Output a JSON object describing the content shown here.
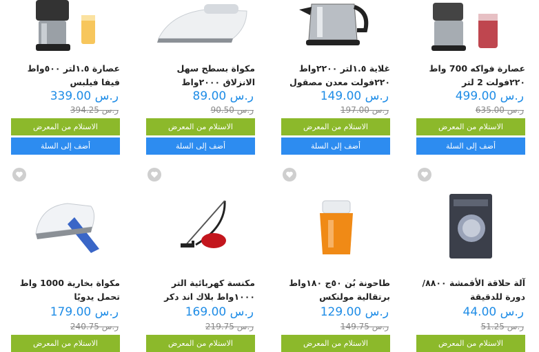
{
  "products": [
    {
      "name": "عصارة ١.٥لتر ٥٠٠واط فيفا فيلبس",
      "price": "ر.س 339.00",
      "old_price": "ر.س 394.25",
      "pickup_label": "الاستلام من المعرض",
      "cart_label": "أضف إلى السلة"
    },
    {
      "name": "مكواة بسطح سهل الانزلاق ٢٠٠٠واط",
      "price": "ر.س 89.00",
      "old_price": "ر.س 90.50",
      "pickup_label": "الاستلام من المعرض",
      "cart_label": "أضف إلى السلة"
    },
    {
      "name": "غلاية ١.٥لتر ٢٢٠٠واط ٢٢٠فولت معدن مصقول",
      "price": "ر.س 149.00",
      "old_price": "ر.س 197.00",
      "pickup_label": "الاستلام من المعرض",
      "cart_label": "أضف إلى السلة"
    },
    {
      "name": "عصارة فواكه 700 واط ٢٢٠فولت 2 لتر",
      "price": "ر.س 499.00",
      "old_price": "ر.س 635.00",
      "pickup_label": "الاستلام من المعرض",
      "cart_label": "أضف إلى السلة"
    },
    {
      "name": "مكواة بخارية 1000 واط تحمل يدويًا",
      "price": "ر.س 179.00",
      "old_price": "ر.س 240.75",
      "pickup_label": "الاستلام من المعرض",
      "cart_label": ""
    },
    {
      "name": "مكنسة كهربائية التر ١٠٠٠واط بلاك اند دكر",
      "price": "ر.س 169.00",
      "old_price": "ر.س 219.75",
      "pickup_label": "الاستلام من المعرض",
      "cart_label": ""
    },
    {
      "name": "طاحونة بُن ٥٠ج ١٨٠واط برتقالية مولنكس",
      "price": "ر.س 129.00",
      "old_price": "ر.س 149.75",
      "pickup_label": "الاستلام من المعرض",
      "cart_label": ""
    },
    {
      "name": "آلة حلاقة الأقمشة ٨٨٠٠/دورة للدقيقة",
      "price": "ر.س 44.00",
      "old_price": "ر.س 51.25",
      "pickup_label": "الاستلام من المعرض",
      "cart_label": ""
    }
  ],
  "colors": {
    "price": "#1e8ce6",
    "pickup_button": "#8cb92b",
    "cart_button": "#2d8cf0"
  },
  "icons": {
    "wishlist": "heart-icon"
  }
}
